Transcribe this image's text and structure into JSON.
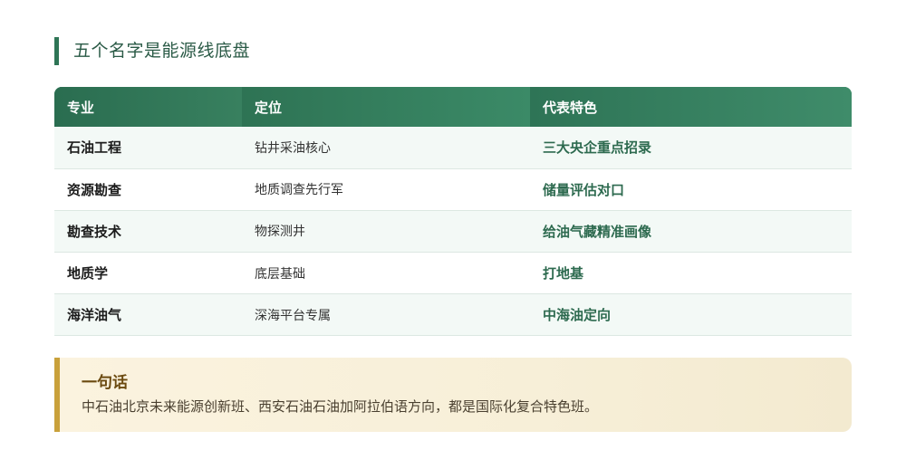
{
  "section": {
    "title": "五个名字是能源线底盘"
  },
  "table": {
    "headers": [
      "专业",
      "定位",
      "代表特色"
    ],
    "rows": [
      {
        "major": "石油工程",
        "position": "钻井采油核心",
        "feature": "三大央企重点招录"
      },
      {
        "major": "资源勘查",
        "position": "地质调查先行军",
        "feature": "储量评估对口"
      },
      {
        "major": "勘查技术",
        "position": "物探测井",
        "feature": "给油气藏精准画像"
      },
      {
        "major": "地质学",
        "position": "底层基础",
        "feature": "打地基"
      },
      {
        "major": "海洋油气",
        "position": "深海平台专属",
        "feature": "中海油定向"
      }
    ]
  },
  "callout": {
    "title": "一句话",
    "text": "中石油北京未来能源创新班、西安石油石油加阿拉伯语方向，都是国际化复合特色班。"
  },
  "colors": {
    "accent_green": "#2e7556",
    "accent_gold": "#c9a13b"
  }
}
